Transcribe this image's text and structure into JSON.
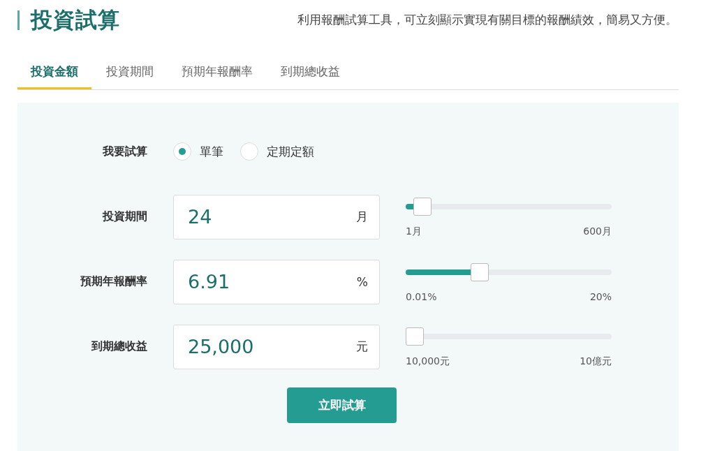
{
  "header": {
    "title": "投資試算",
    "description": "利用報酬試算工具，可立刻顯示實現有關目標的報酬績效，簡易又方便。"
  },
  "tabs": [
    {
      "label": "投資金額",
      "selected": true
    },
    {
      "label": "投資期間",
      "selected": false
    },
    {
      "label": "預期年報酬率",
      "selected": false
    },
    {
      "label": "到期總收益",
      "selected": false
    }
  ],
  "calc_type": {
    "label": "我要試算",
    "options": [
      {
        "label": "單筆",
        "selected": true
      },
      {
        "label": "定期定額",
        "selected": false
      }
    ]
  },
  "fields": [
    {
      "label": "投資期間",
      "value": "24",
      "unit": "月",
      "level": 0.04,
      "min": "1月",
      "max": "600月"
    },
    {
      "label": "預期年報酬率",
      "value": "6.91",
      "unit": "%",
      "level": 0.345,
      "min": "0.01%",
      "max": "20%"
    },
    {
      "label": "到期總收益",
      "value": "25,000",
      "unit": "元",
      "level": 0,
      "min": "10,000元",
      "max": "10億元"
    }
  ],
  "submit_button": "立即試算"
}
